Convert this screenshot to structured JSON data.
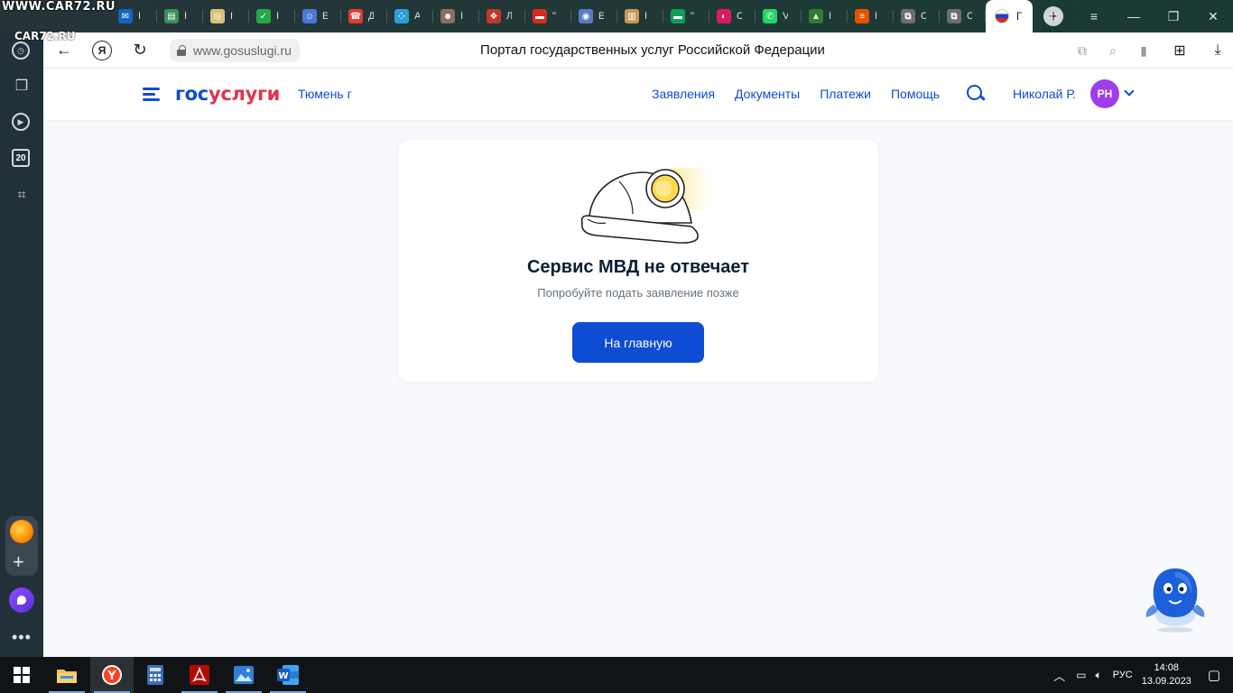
{
  "watermark": {
    "line1": "WWW.CAR72.RU",
    "line2": "CAR72.RU",
    "badge": "20"
  },
  "tabs": [
    {
      "icon": "mail-icon",
      "color": "#1565c0",
      "glyph": "✉",
      "title": "I"
    },
    {
      "icon": "printer-icon",
      "color": "#3a8f5a",
      "glyph": "▤",
      "title": "I"
    },
    {
      "icon": "photo-icon",
      "color": "#d8c27a",
      "glyph": "◎",
      "title": "I"
    },
    {
      "icon": "check-icon",
      "color": "#27a844",
      "glyph": "✓",
      "title": "I"
    },
    {
      "icon": "robot-icon",
      "color": "#4a78d8",
      "glyph": "☺",
      "title": "E"
    },
    {
      "icon": "phone-icon",
      "color": "#e53935",
      "glyph": "☎",
      "title": "Д"
    },
    {
      "icon": "dots-icon",
      "color": "#2aa0d8",
      "glyph": "⁘",
      "title": "A"
    },
    {
      "icon": "person-icon",
      "color": "#8a6d5a",
      "glyph": "☻",
      "title": "I"
    },
    {
      "icon": "emblem-icon",
      "color": "#c0392b",
      "glyph": "❖",
      "title": "Л"
    },
    {
      "icon": "flag-icon",
      "color": "#d52b1e",
      "glyph": "▬",
      "title": "\""
    },
    {
      "icon": "seal-icon",
      "color": "#5b7cc2",
      "glyph": "◉",
      "title": "E"
    },
    {
      "icon": "document-icon",
      "color": "#c49a55",
      "glyph": "▥",
      "title": "I"
    },
    {
      "icon": "flag-icon",
      "color": "#0f9d58",
      "glyph": "▬",
      "title": "\""
    },
    {
      "icon": "circle-icon",
      "color": "#d81b60",
      "glyph": "◐",
      "title": "C"
    },
    {
      "icon": "whatsapp-icon",
      "color": "#25d366",
      "glyph": "✆",
      "title": "V"
    },
    {
      "icon": "mountain-icon",
      "color": "#2e7d32",
      "glyph": "▲",
      "title": "I"
    },
    {
      "icon": "logo-icon",
      "color": "#e65100",
      "glyph": "≡",
      "title": "I"
    },
    {
      "icon": "copy-icon",
      "color": "#6d6d6d",
      "glyph": "⧉",
      "title": "C"
    },
    {
      "icon": "copy-icon",
      "color": "#6d6d6d",
      "glyph": "⧉",
      "title": "C"
    }
  ],
  "active_tab": {
    "icon": "russia-flag-icon",
    "title": "Г"
  },
  "addressbar": {
    "url": "www.gosuslugi.ru",
    "page_title": "Портал государственных услуг Российской Федерации",
    "ya": "Я"
  },
  "sidebar": {
    "calendar_number": "20"
  },
  "site": {
    "logo_part1": "гос",
    "logo_part2": "услуги",
    "city": "Тюмень г",
    "nav": [
      "Заявления",
      "Документы",
      "Платежи",
      "Помощь"
    ],
    "user_name": "Николай Р.",
    "avatar_initials": "РН"
  },
  "error": {
    "title": "Сервис МВД не отвечает",
    "subtitle": "Попробуйте подать заявление позже",
    "button": "На главную"
  },
  "taskbar": {
    "apps": [
      "file-explorer-icon",
      "yandex-browser-icon",
      "calculator-icon",
      "pdf-icon",
      "photos-icon",
      "word-icon"
    ],
    "language": "РУС",
    "time": "14:08",
    "date": "13.09.2023"
  },
  "colors": {
    "brand_blue": "#0d4cd3",
    "brand_red": "#e4334b",
    "avatar": "#9f3ded"
  }
}
